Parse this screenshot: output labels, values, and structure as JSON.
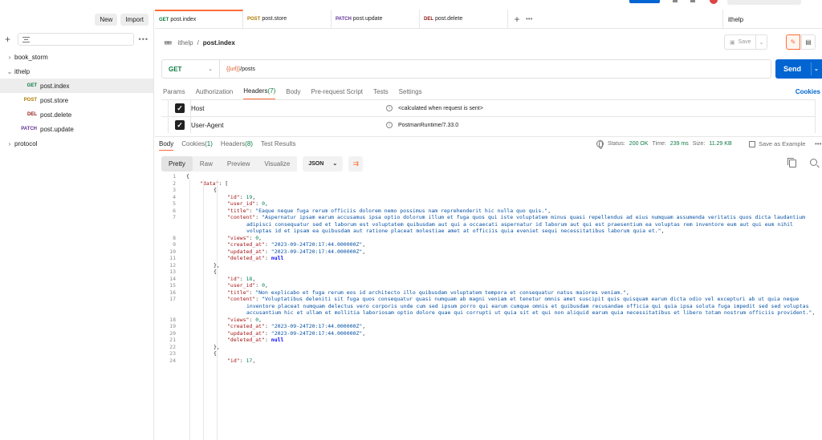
{
  "sidebar": {
    "new_label": "New",
    "import_label": "Import",
    "items": [
      {
        "type": "collection",
        "label": "book_storm",
        "chevron": "›"
      },
      {
        "type": "collection",
        "label": "ithelp",
        "chevron": "⌄"
      },
      {
        "type": "request",
        "method": "GET",
        "label": "post.index",
        "selected": true
      },
      {
        "type": "request",
        "method": "POST",
        "label": "post.store"
      },
      {
        "type": "request",
        "method": "DEL",
        "label": "post.delete"
      },
      {
        "type": "request",
        "method": "PATCH",
        "label": "post.update"
      },
      {
        "type": "collection",
        "label": "protocol",
        "chevron": "›"
      }
    ]
  },
  "tabs": [
    {
      "method": "GET",
      "label": "post.index",
      "active": true
    },
    {
      "method": "POST",
      "label": "post.store"
    },
    {
      "method": "PATCH",
      "label": "post.update"
    },
    {
      "method": "DEL",
      "label": "post.delete"
    }
  ],
  "environment": "ithelp",
  "breadcrumb": {
    "icon": "http-icon",
    "collection": "ithelp",
    "separator": "/",
    "request": "post.index"
  },
  "save_label": "Save",
  "request": {
    "method": "GET",
    "url_var": "{{url}}",
    "url_path": "/posts",
    "send_label": "Send"
  },
  "request_tabs": [
    {
      "label": "Params"
    },
    {
      "label": "Authorization"
    },
    {
      "label": "Headers",
      "count": " (7)",
      "active": true
    },
    {
      "label": "Body"
    },
    {
      "label": "Pre-request Script"
    },
    {
      "label": "Tests"
    },
    {
      "label": "Settings"
    }
  ],
  "cookies_label": "Cookies",
  "headers": [
    {
      "key": "Host",
      "value": "<calculated when request is sent>"
    },
    {
      "key": "User-Agent",
      "value": "PostmanRuntime/7.33.0"
    }
  ],
  "response_tabs": [
    {
      "label": "Body",
      "active": true
    },
    {
      "label": "Cookies",
      "count": " (1)"
    },
    {
      "label": "Headers",
      "count": " (8)"
    },
    {
      "label": "Test Results"
    }
  ],
  "response_status": {
    "status_label": "Status:",
    "status": "200 OK",
    "time_label": "Time:",
    "time": "239 ms",
    "size_label": "Size:",
    "size": "11.29 KB",
    "save_example": "Save as Example"
  },
  "view_modes": [
    {
      "label": "Pretty",
      "active": true
    },
    {
      "label": "Raw"
    },
    {
      "label": "Preview"
    },
    {
      "label": "Visualize"
    }
  ],
  "format": "JSON",
  "code_lines": [
    {
      "n": "1",
      "indent": 0,
      "parts": [
        [
          "p",
          "{"
        ]
      ]
    },
    {
      "n": "2",
      "indent": 1,
      "parts": [
        [
          "k",
          "\"data\""
        ],
        [
          "p",
          ": ["
        ]
      ]
    },
    {
      "n": "3",
      "indent": 2,
      "parts": [
        [
          "p",
          "{"
        ]
      ]
    },
    {
      "n": "4",
      "indent": 3,
      "parts": [
        [
          "k",
          "\"id\""
        ],
        [
          "p",
          ": "
        ],
        [
          "n",
          "19"
        ],
        [
          "p",
          ","
        ]
      ]
    },
    {
      "n": "5",
      "indent": 3,
      "parts": [
        [
          "k",
          "\"user_id\""
        ],
        [
          "p",
          ": "
        ],
        [
          "n",
          "0"
        ],
        [
          "p",
          ","
        ]
      ]
    },
    {
      "n": "6",
      "indent": 3,
      "parts": [
        [
          "k",
          "\"title\""
        ],
        [
          "p",
          ": "
        ],
        [
          "s",
          "\"Eaque neque fuga rerum officiis dolorem nemo possimus nam reprehenderit hic nulla quo quis.\""
        ],
        [
          "p",
          ","
        ]
      ]
    },
    {
      "n": "7",
      "indent": 3,
      "wrap": true,
      "parts": [
        [
          "k",
          "\"content\""
        ],
        [
          "p",
          ": "
        ],
        [
          "s",
          "\"Aspernatur ipsam earum accusamus ipsa optio dolorum illum et fuga quos qui iste voluptatem minus quasi repellendus ad eius numquam assumenda veritatis quos dicta laudantium adipisci consequatur sed et laborum est voluptatem quibusdam aut qui a occaecati aspernatur id laborum aut qui est praesentium ea voluptas rem inventore eum aut qui eum nihil voluptas id et ipsam ea quibusdam aut ratione placeat molestiae amet at officiis quia eveniet sequi necessitatibus laborum quia et.\""
        ],
        [
          "p",
          ","
        ]
      ]
    },
    {
      "n": "8",
      "indent": 3,
      "parts": [
        [
          "k",
          "\"views\""
        ],
        [
          "p",
          ": "
        ],
        [
          "n",
          "0"
        ],
        [
          "p",
          ","
        ]
      ]
    },
    {
      "n": "9",
      "indent": 3,
      "parts": [
        [
          "k",
          "\"created_at\""
        ],
        [
          "p",
          ": "
        ],
        [
          "s",
          "\"2023-09-24T20:17:44.000000Z\""
        ],
        [
          "p",
          ","
        ]
      ]
    },
    {
      "n": "10",
      "indent": 3,
      "parts": [
        [
          "k",
          "\"updated_at\""
        ],
        [
          "p",
          ": "
        ],
        [
          "s",
          "\"2023-09-24T20:17:44.000000Z\""
        ],
        [
          "p",
          ","
        ]
      ]
    },
    {
      "n": "11",
      "indent": 3,
      "parts": [
        [
          "k",
          "\"deleted_at\""
        ],
        [
          "p",
          ": "
        ],
        [
          "kw",
          "null"
        ]
      ]
    },
    {
      "n": "12",
      "indent": 2,
      "parts": [
        [
          "p",
          "},"
        ]
      ]
    },
    {
      "n": "13",
      "indent": 2,
      "parts": [
        [
          "p",
          "{"
        ]
      ]
    },
    {
      "n": "14",
      "indent": 3,
      "parts": [
        [
          "k",
          "\"id\""
        ],
        [
          "p",
          ": "
        ],
        [
          "n",
          "18"
        ],
        [
          "p",
          ","
        ]
      ]
    },
    {
      "n": "15",
      "indent": 3,
      "parts": [
        [
          "k",
          "\"user_id\""
        ],
        [
          "p",
          ": "
        ],
        [
          "n",
          "0"
        ],
        [
          "p",
          ","
        ]
      ]
    },
    {
      "n": "16",
      "indent": 3,
      "parts": [
        [
          "k",
          "\"title\""
        ],
        [
          "p",
          ": "
        ],
        [
          "s",
          "\"Non explicabo et fuga rerum eos id architecto illo quibusdam voluptatem tempora et consequatur natus maiores veniam.\""
        ],
        [
          "p",
          ","
        ]
      ]
    },
    {
      "n": "17",
      "indent": 3,
      "wrap": true,
      "parts": [
        [
          "k",
          "\"content\""
        ],
        [
          "p",
          ": "
        ],
        [
          "s",
          "\"Voluptatibus deleniti sit fuga quos consequatur quasi numquam ab magni veniam et tenetur omnis amet suscipit quis quisquam earum dicta odio vel excepturi ab ut quia neque inventore placeat numquam delectus vero corporis unde cum sed ipsum porro qui earum cumque omnis et quibusdam recusandae officia qui quia ipsa soluta fuga impedit sed sed voluptas accusantium hic et ullam et mollitia laboriosam optio dolore quae qui corrupti ut quia sit et qui non aliquid earum quia necessitatibus et libero totam nostrum officiis provident.\""
        ],
        [
          "p",
          ","
        ]
      ]
    },
    {
      "n": "18",
      "indent": 3,
      "parts": [
        [
          "k",
          "\"views\""
        ],
        [
          "p",
          ": "
        ],
        [
          "n",
          "0"
        ],
        [
          "p",
          ","
        ]
      ]
    },
    {
      "n": "19",
      "indent": 3,
      "parts": [
        [
          "k",
          "\"created_at\""
        ],
        [
          "p",
          ": "
        ],
        [
          "s",
          "\"2023-09-24T20:17:44.000000Z\""
        ],
        [
          "p",
          ","
        ]
      ]
    },
    {
      "n": "20",
      "indent": 3,
      "parts": [
        [
          "k",
          "\"updated_at\""
        ],
        [
          "p",
          ": "
        ],
        [
          "s",
          "\"2023-09-24T20:17:44.000000Z\""
        ],
        [
          "p",
          ","
        ]
      ]
    },
    {
      "n": "21",
      "indent": 3,
      "parts": [
        [
          "k",
          "\"deleted_at\""
        ],
        [
          "p",
          ": "
        ],
        [
          "kw",
          "null"
        ]
      ]
    },
    {
      "n": "22",
      "indent": 2,
      "parts": [
        [
          "p",
          "},"
        ]
      ]
    },
    {
      "n": "23",
      "indent": 2,
      "parts": [
        [
          "p",
          "{"
        ]
      ]
    },
    {
      "n": "24",
      "indent": 3,
      "parts": [
        [
          "k",
          "\"id\""
        ],
        [
          "p",
          ": "
        ],
        [
          "n",
          "17"
        ],
        [
          "p",
          ","
        ]
      ]
    }
  ]
}
